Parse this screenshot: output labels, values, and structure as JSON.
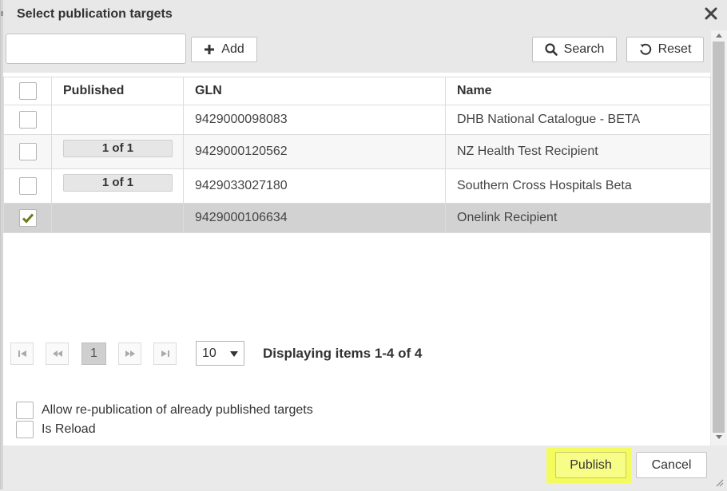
{
  "dialog": {
    "title": "Select publication targets",
    "close_icon": "close-icon"
  },
  "toolbar": {
    "search_value": "",
    "add_label": "Add",
    "search_label": "Search",
    "reset_label": "Reset"
  },
  "grid": {
    "columns": [
      "",
      "Published",
      "GLN",
      "Name"
    ],
    "rows": [
      {
        "checked": false,
        "published": "",
        "gln": "9429000098083",
        "name": "DHB National Catalogue - BETA"
      },
      {
        "checked": false,
        "published": "1 of 1",
        "gln": "9429000120562",
        "name": "NZ Health Test Recipient"
      },
      {
        "checked": false,
        "published": "1 of 1",
        "gln": "9429033027180",
        "name": "Southern Cross Hospitals Beta"
      },
      {
        "checked": true,
        "published": "",
        "gln": "9429000106634",
        "name": "Onelink Recipient"
      }
    ]
  },
  "pager": {
    "current_page": "1",
    "page_size": "10",
    "info": "Displaying items 1-4 of 4"
  },
  "options": {
    "republish_label": "Allow re-publication of already published targets",
    "reload_label": "Is Reload"
  },
  "footer": {
    "publish_label": "Publish",
    "cancel_label": "Cancel"
  },
  "colors": {
    "highlight": "#f4fb5c",
    "selected_row": "#d2d2d2",
    "checkmark": "#6b7a1c"
  }
}
